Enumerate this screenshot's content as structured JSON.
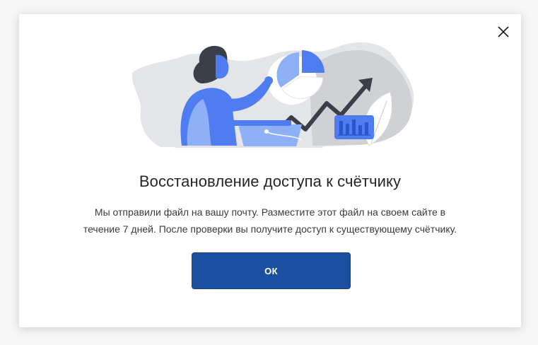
{
  "dialog": {
    "title": "Восстановление доступа к счётчику",
    "message_line1": "Мы отправили файл на вашу почту. Разместите этот файл на своем сайте в",
    "message_line2": "течение 7 дней. После проверки вы получите доступ к существующему счётчику.",
    "ok_label": "ОК",
    "close_icon": "close-icon"
  },
  "colors": {
    "primary_button": "#1b4fa0",
    "illustration_blue": "#4f7cf0",
    "illustration_light_blue": "#8eb0f7",
    "illustration_gray": "#d9dadd",
    "illustration_dark": "#3b3f4a"
  }
}
